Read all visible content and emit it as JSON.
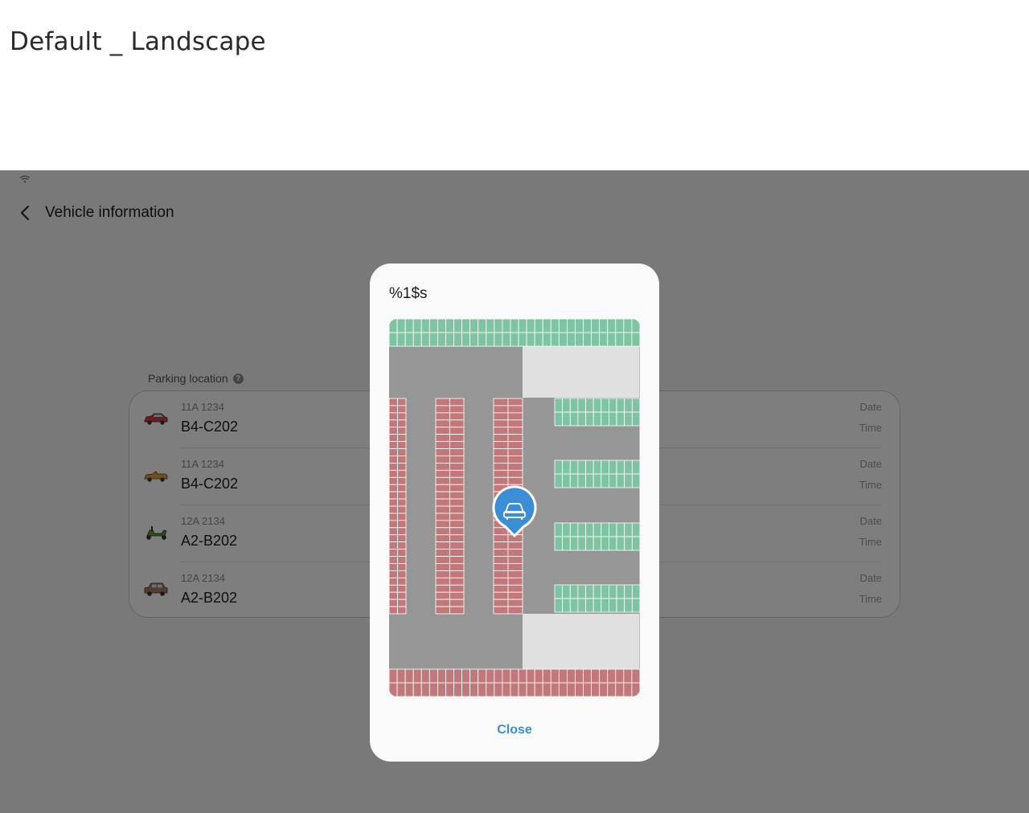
{
  "document_title": "Default _ Landscape",
  "app_bar": {
    "title": "Vehicle information"
  },
  "section": {
    "label": "Parking location",
    "help_glyph": "?"
  },
  "vehicles": [
    {
      "plate": "11A 1234",
      "location": "B4-C202",
      "date_label": "Date",
      "time_label": "Time",
      "icon": "red-car-icon"
    },
    {
      "plate": "11A 1234",
      "location": "B4-C202",
      "date_label": "Date",
      "time_label": "Time",
      "icon": "convertible-icon"
    },
    {
      "plate": "12A 2134",
      "location": "A2-B202",
      "date_label": "Date",
      "time_label": "Time",
      "icon": "scooter-icon"
    },
    {
      "plate": "12A 2134",
      "location": "A2-B202",
      "date_label": "Date",
      "time_label": "Time",
      "icon": "suv-icon"
    }
  ],
  "dialog": {
    "title": "%1$s",
    "close_label": "Close",
    "map_pin_icon": "car-pin-icon"
  },
  "colors": {
    "accent": "#3a8ed6",
    "occupied_stall": "#c0787a",
    "free_stall": "#7fc4a2",
    "road": "#969696",
    "empty_area": "#e0e0e0"
  }
}
